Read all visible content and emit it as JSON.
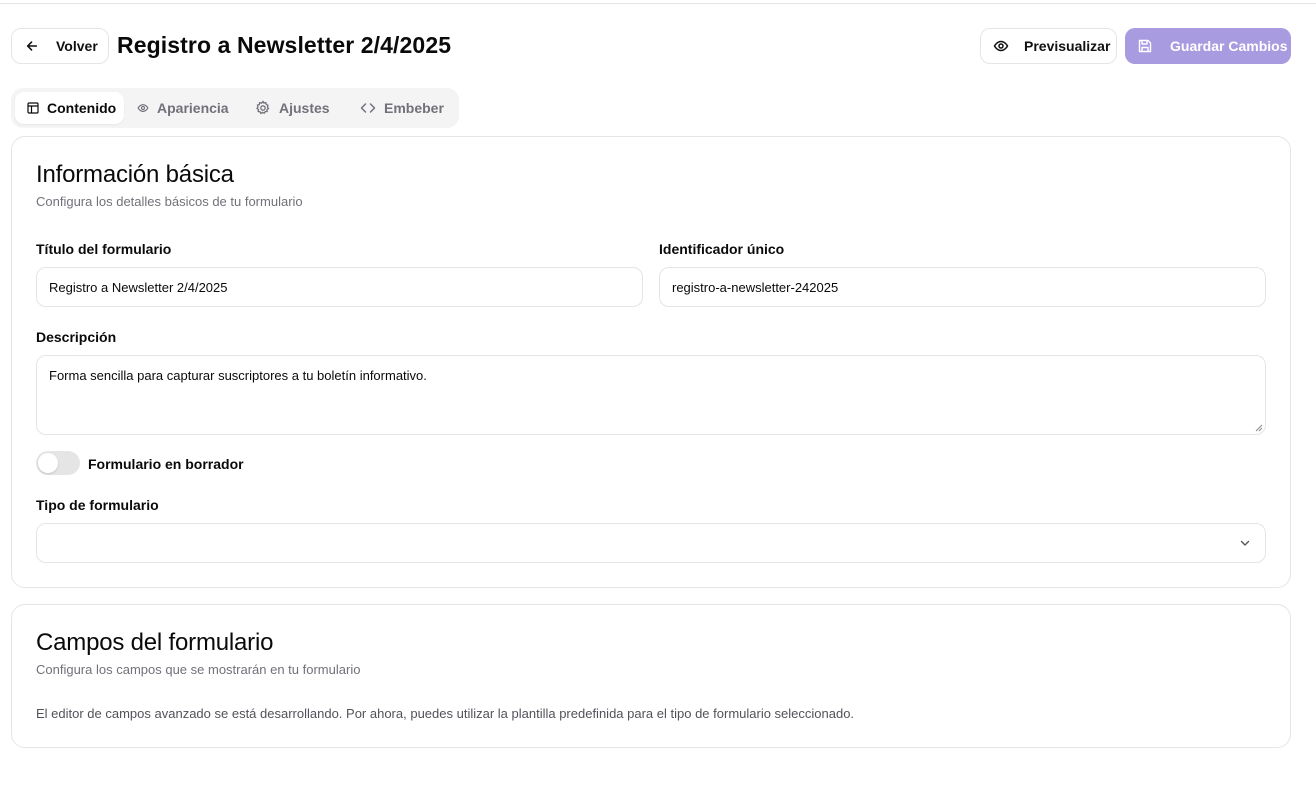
{
  "header": {
    "back_label": "Volver",
    "title": "Registro a Newsletter 2/4/2025",
    "preview_label": "Previsualizar",
    "save_label": "Guardar Cambios"
  },
  "tabs": [
    {
      "label": "Contenido",
      "icon": "layout-icon",
      "active": true
    },
    {
      "label": "Apariencia",
      "icon": "eye-icon",
      "active": false
    },
    {
      "label": "Ajustes",
      "icon": "gear-icon",
      "active": false
    },
    {
      "label": "Embeber",
      "icon": "code-icon",
      "active": false
    }
  ],
  "basic_info": {
    "title": "Información básica",
    "subtitle": "Configura los detalles básicos de tu formulario",
    "form_title_label": "Título del formulario",
    "form_title_value": "Registro a Newsletter 2/4/2025",
    "slug_label": "Identificador único",
    "slug_value": "registro-a-newsletter-242025",
    "description_label": "Descripción",
    "description_value": "Forma sencilla para capturar suscriptores a tu boletín informativo.",
    "draft_toggle_label": "Formulario en borrador",
    "draft_toggle_on": false,
    "form_type_label": "Tipo de formulario",
    "form_type_value": ""
  },
  "fields_section": {
    "title": "Campos del formulario",
    "subtitle": "Configura los campos que se mostrarán en tu formulario",
    "note": "El editor de campos avanzado se está desarrollando. Por ahora, puedes utilizar la plantilla predefinida para el tipo de formulario seleccionado."
  },
  "colors": {
    "accent": "#a89be0",
    "border": "#e5e5e5",
    "muted_text": "#71717a"
  }
}
